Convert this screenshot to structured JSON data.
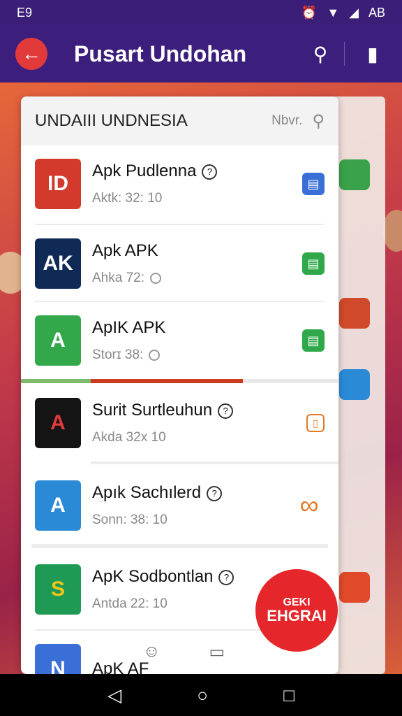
{
  "status_bar": {
    "left": "E9",
    "right_text": "AB"
  },
  "app_bar": {
    "title": "Pusart Undohan"
  },
  "panel": {
    "title": "UNDAIII UNDNESIA",
    "filter_label": "Nbvr."
  },
  "items": [
    {
      "name": "Apk Pudlenna",
      "sub": "Aktk: 32: 10",
      "icon_text": "ID",
      "icon_color": "#d33a2c",
      "action_color": "#3a6fd8"
    },
    {
      "name": "Apk APK",
      "sub": "Ahka 72:",
      "icon_text": "AK",
      "icon_color": "#0f2a55",
      "action_color": "#2fa84a"
    },
    {
      "name": "ApIK APK",
      "sub": "Storɪ 38:",
      "icon_text": "A",
      "icon_color": "#33a84a",
      "action_color": "#2fa84a"
    },
    {
      "name": "Surit Surtleuhun",
      "sub": "Akda 32x 10",
      "icon_text": "A",
      "icon_color": "#141414",
      "action_color": "#e07a2a"
    },
    {
      "name": "Apık Sachılerd",
      "sub": "Sonn: 38: 10",
      "icon_text": "A",
      "icon_color": "#2b8ad6",
      "action_color": "#e07a2a"
    },
    {
      "name": "ApK Sodbontlan",
      "sub": "Antda 22: 10",
      "icon_text": "S",
      "icon_color": "#1e9a55",
      "action_color": "#e07a2a"
    },
    {
      "name": "ApK AF",
      "sub": "",
      "icon_text": "N",
      "icon_color": "#3a6fd8",
      "action_color": "#2fa84a"
    }
  ],
  "progress": {
    "green_fraction": 0.22,
    "red_fraction": 0.48
  },
  "fab": {
    "line1": "GEKI",
    "line2": "EHGRAI"
  }
}
